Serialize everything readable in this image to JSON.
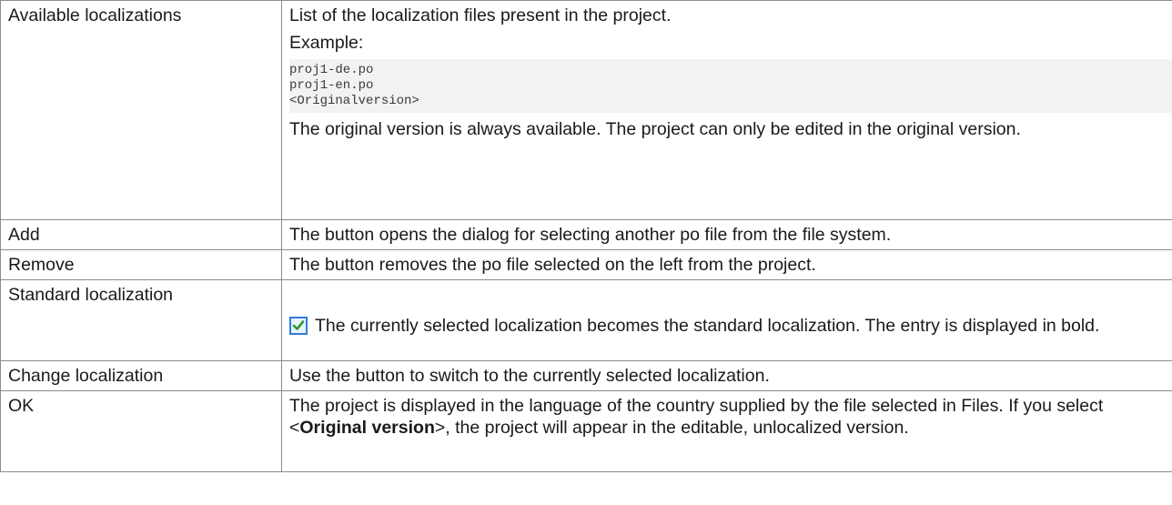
{
  "rows": {
    "available": {
      "term": "Available localizations",
      "desc": "List of the localization files present in the project.",
      "example_label": "Example:",
      "code_lines": [
        "proj1-de.po",
        "proj1-en.po",
        "<Originalversion>"
      ],
      "note": "The original version is always available. The project can only be edited in the original version."
    },
    "add": {
      "term": "Add",
      "desc": "The button opens the dialog for selecting another po file from the file system."
    },
    "remove": {
      "term": "Remove",
      "desc": "The button removes the po file selected on the left from the project."
    },
    "standard": {
      "term": "Standard localization",
      "icon": "checkbox-checked-icon",
      "desc": "The currently selected localization becomes the standard localization. The entry is displayed in bold."
    },
    "change": {
      "term": "Change localization",
      "desc": "Use the button to switch to the currently selected localization."
    },
    "ok": {
      "term": "OK",
      "desc_before": "The project is displayed in the language of the country supplied by the file selected in Files. If you select <",
      "desc_bold": "Original version",
      "desc_after": ">, the project will appear in the editable, unlocalized version."
    }
  }
}
